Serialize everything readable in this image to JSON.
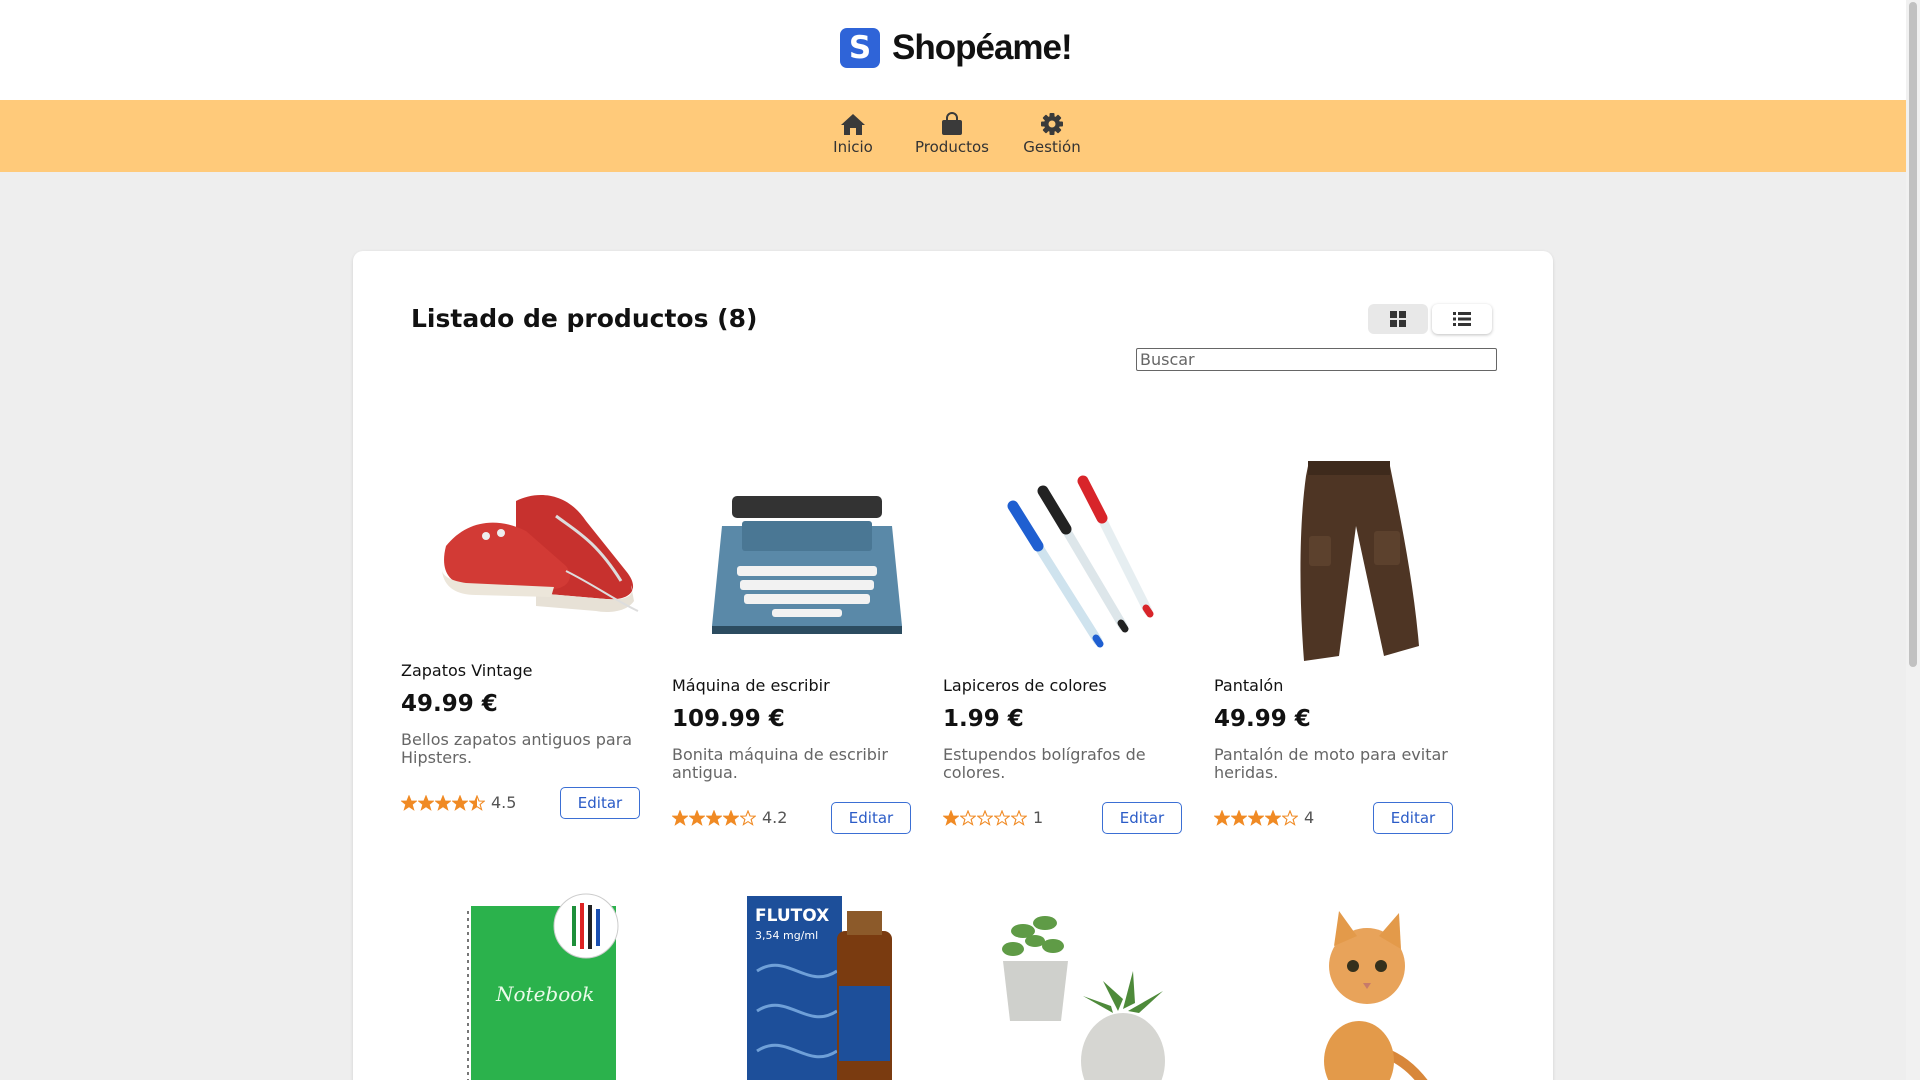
{
  "brand": {
    "logo_letter": "S",
    "name": "Shopéame!",
    "color": "#2f64d8"
  },
  "nav": {
    "items": [
      {
        "label": "Inicio",
        "icon": "home-icon"
      },
      {
        "label": "Productos",
        "icon": "shopping-bag-icon"
      },
      {
        "label": "Gestión",
        "icon": "gear-icon"
      }
    ],
    "background": "#ffca7a"
  },
  "listing": {
    "title": "Listado de productos (8)",
    "view_modes": [
      "grid-view-icon",
      "list-view-icon"
    ],
    "active_view": "list",
    "search": {
      "placeholder": "Buscar",
      "value": ""
    }
  },
  "products": [
    {
      "name": "Zapatos Vintage",
      "price": "49.99 €",
      "description": "Bellos zapatos antiguos para Hipsters.",
      "rating": 4.5,
      "rating_label": "4.5",
      "edit_label": "Editar",
      "image": "red-sneakers-image"
    },
    {
      "name": "Máquina de escribir",
      "price": "109.99 €",
      "description": "Bonita máquina de escribir antigua.",
      "rating": 4.2,
      "rating_label": "4.2",
      "edit_label": "Editar",
      "image": "typewriter-image"
    },
    {
      "name": "Lapiceros de colores",
      "price": "1.99 €",
      "description": "Estupendos bolígrafos de colores.",
      "rating": 1,
      "rating_label": "1",
      "edit_label": "Editar",
      "image": "pens-image"
    },
    {
      "name": "Pantalón",
      "price": "49.99 €",
      "description": "Pantalón de moto para evitar heridas.",
      "rating": 4,
      "rating_label": "4",
      "edit_label": "Editar",
      "image": "brown-trousers-image"
    },
    {
      "image": "notebook-image",
      "notebook_text": "Notebook"
    },
    {
      "image": "flutox-syrup-image",
      "brand_text": "FLUTOX",
      "dose_text": "3,54 mg/ml"
    },
    {
      "image": "succulent-plants-image"
    },
    {
      "image": "kitten-image"
    }
  ],
  "colors": {
    "star": "#f08a24",
    "edit_button": "#2a5bc7",
    "page_bg": "#eeeeee"
  }
}
